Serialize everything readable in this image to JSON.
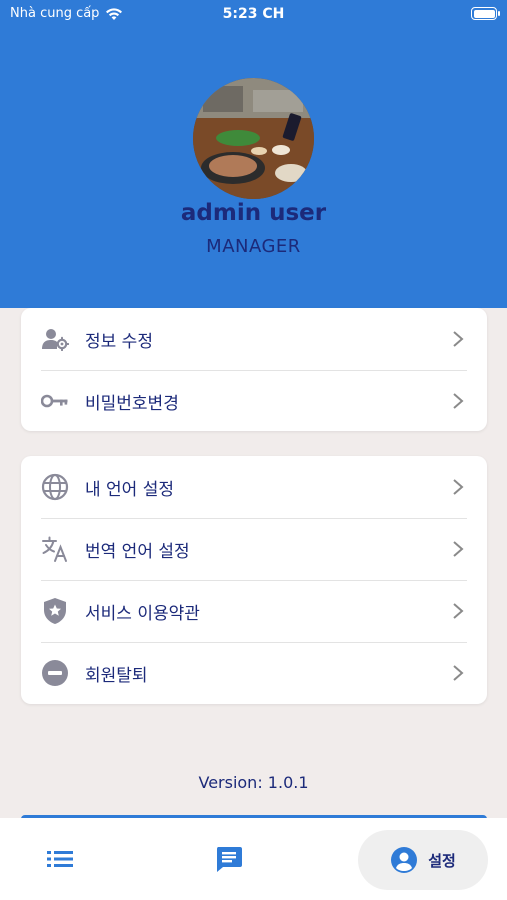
{
  "status_bar": {
    "carrier": "Nhà cung cấp",
    "time": "5:23 CH"
  },
  "profile": {
    "name": "admin user",
    "role": "MANAGER"
  },
  "account_menu": [
    {
      "label": "정보 수정",
      "icon": "user-settings-icon"
    },
    {
      "label": "비밀번호변경",
      "icon": "key-icon"
    }
  ],
  "settings_menu": [
    {
      "label": "내 언어 설정",
      "icon": "globe-icon"
    },
    {
      "label": "번역 언어 설정",
      "icon": "translate-icon"
    },
    {
      "label": "서비스 이용약관",
      "icon": "shield-star-icon"
    },
    {
      "label": "회원탈퇴",
      "icon": "minus-circle-icon"
    }
  ],
  "version": "Version: 1.0.1",
  "bottom_nav": {
    "settings_label": "설정"
  },
  "colors": {
    "header_blue": "#2f7bd7",
    "text_navy": "#1c2a7a",
    "icon_gray": "#8a8a99",
    "background": "#f1eceb"
  }
}
